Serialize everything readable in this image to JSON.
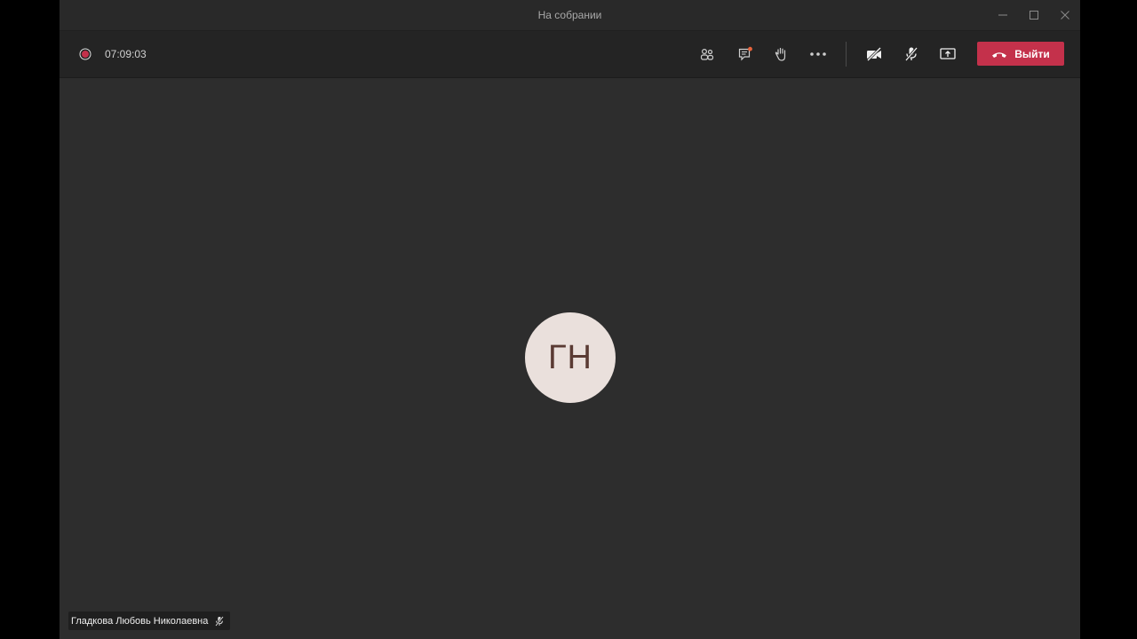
{
  "window": {
    "title": "На собрании"
  },
  "toolbar": {
    "recording_indicator_color": "#c4314b",
    "elapsed_time": "07:09:03",
    "buttons": [
      {
        "id": "participants",
        "icon": "people-icon"
      },
      {
        "id": "chat",
        "icon": "chat-icon",
        "has_notification": true
      },
      {
        "id": "raise-hand",
        "icon": "hand-icon"
      },
      {
        "id": "more",
        "icon": "more-icon"
      },
      {
        "id": "camera",
        "icon": "camera-off-icon",
        "state": "off"
      },
      {
        "id": "microphone",
        "icon": "mic-off-icon",
        "state": "muted"
      },
      {
        "id": "share",
        "icon": "share-screen-icon"
      }
    ],
    "leave_label": "Выйти",
    "leave_color": "#c4314b"
  },
  "stage": {
    "participant": {
      "initials": "ГН",
      "name": "Гладкова Любовь Николаевна",
      "muted": true,
      "avatar_color": "#eae0dc"
    }
  }
}
